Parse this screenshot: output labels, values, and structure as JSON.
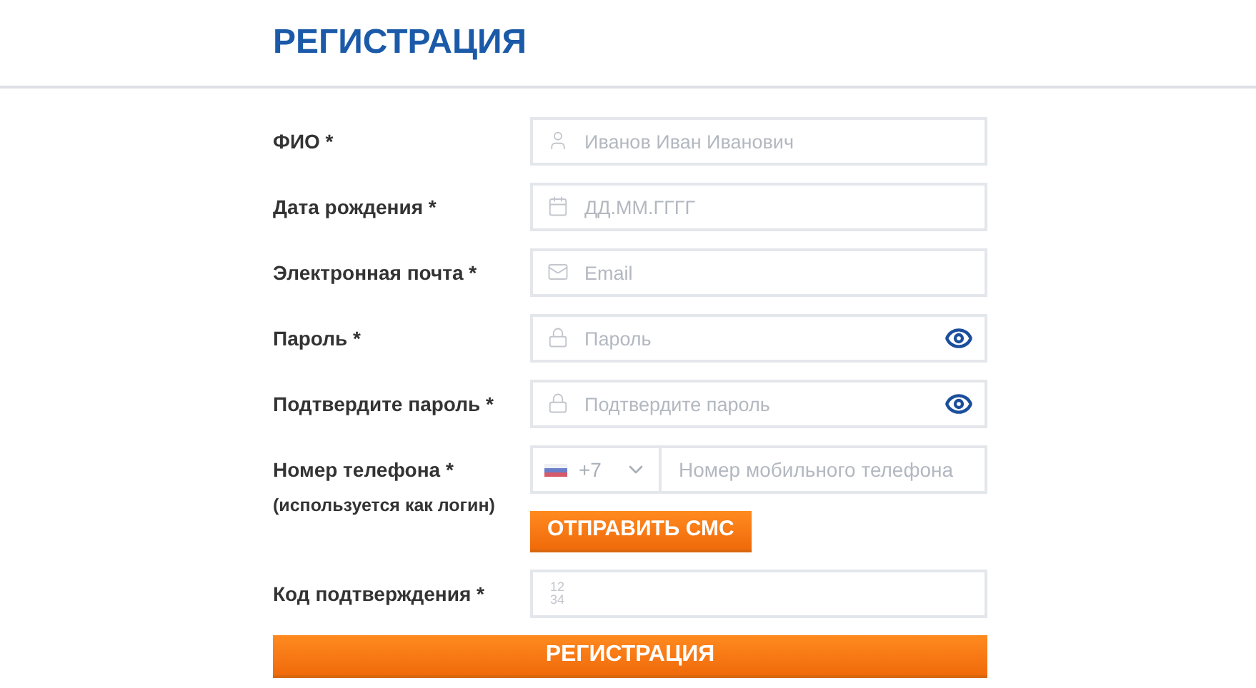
{
  "title": "РЕГИСТРАЦИЯ",
  "fields": [
    {
      "kind": "name",
      "label": "ФИО *",
      "placeholder": "Иванов Иван Иванович"
    },
    {
      "kind": "date",
      "label": "Дата рождения *",
      "placeholder": "ДД.ММ.ГГГГ"
    },
    {
      "kind": "email",
      "label": "Электронная почта *",
      "placeholder": "Email"
    },
    {
      "kind": "password",
      "label": "Пароль *",
      "placeholder": "Пароль"
    },
    {
      "kind": "password",
      "label": "Подтвердите пароль *",
      "placeholder": "Подтвердите пароль"
    },
    {
      "kind": "phone",
      "label": "Номер телефона *",
      "note": "(используется как логин)",
      "code": "+7",
      "placeholder": "Номер мобильного телефона",
      "button": "ОТПРАВИТЬ СМС"
    },
    {
      "kind": "code",
      "label": "Код подтверждения *",
      "digits": [
        "12",
        "34"
      ]
    }
  ],
  "submit": "РЕГИСТРАЦИЯ"
}
